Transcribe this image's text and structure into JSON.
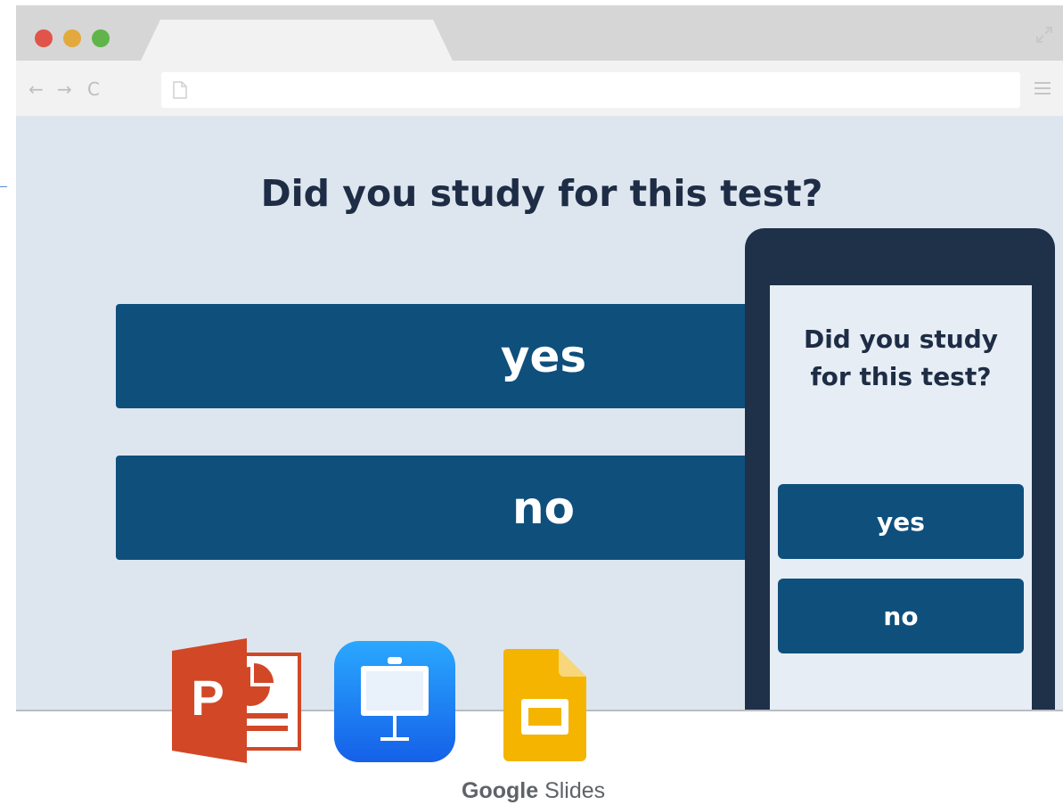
{
  "browser": {
    "window_controls": [
      "close",
      "minimize",
      "maximize"
    ],
    "address_bar": {
      "value": ""
    },
    "nav_icons": {
      "back": "←",
      "forward": "→",
      "reload": "C"
    }
  },
  "page": {
    "question": "Did you study for this test?",
    "answers": {
      "yes": "yes",
      "no": "no"
    }
  },
  "phone": {
    "question_line1": "Did you study",
    "question_line2": "for this test?",
    "answers": {
      "yes": "yes",
      "no": "no"
    }
  },
  "apps": {
    "powerpoint": {
      "letter": "P",
      "icon": "powerpoint-icon"
    },
    "keynote": {
      "icon": "keynote-icon"
    },
    "google_slides": {
      "icon": "google-slides-icon",
      "label_bold": "Google",
      "label_light": "Slides"
    }
  },
  "colors": {
    "button": "#0f4f7c",
    "heading": "#1e2d45",
    "page_bg": "#dde6ef",
    "phone_frame": "#1f3049"
  }
}
